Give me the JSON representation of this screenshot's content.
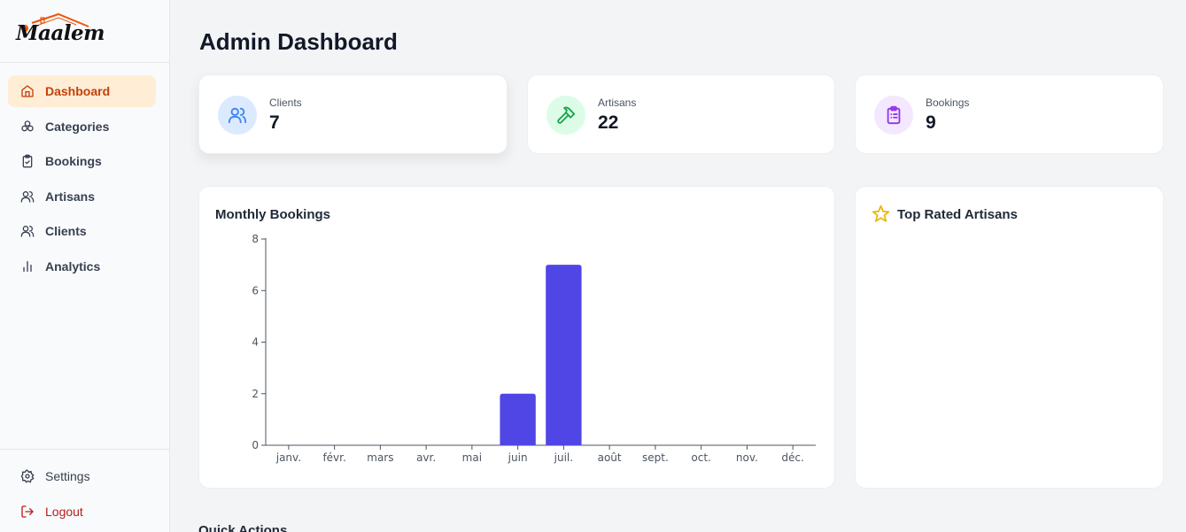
{
  "brand": {
    "name": "Maalem",
    "logo_icon": "house-roof-logo-icon"
  },
  "sidebar": {
    "items": [
      {
        "label": "Dashboard",
        "icon": "home-icon",
        "active": true
      },
      {
        "label": "Categories",
        "icon": "categories-icon",
        "active": false
      },
      {
        "label": "Bookings",
        "icon": "clipboard-check-icon",
        "active": false
      },
      {
        "label": "Artisans",
        "icon": "users-icon",
        "active": false
      },
      {
        "label": "Clients",
        "icon": "users-icon",
        "active": false
      },
      {
        "label": "Analytics",
        "icon": "bar-chart-icon",
        "active": false
      }
    ],
    "bottom": [
      {
        "label": "Settings",
        "icon": "gear-icon"
      },
      {
        "label": "Logout",
        "icon": "logout-icon"
      }
    ]
  },
  "header": {
    "title": "Admin Dashboard"
  },
  "stats": [
    {
      "label": "Clients",
      "value": "7",
      "icon": "users-icon",
      "color": "#3b82f6",
      "bg": "#dbeafe"
    },
    {
      "label": "Artisans",
      "value": "22",
      "icon": "hammer-icon",
      "color": "#16a34a",
      "bg": "#dcfce7"
    },
    {
      "label": "Bookings",
      "value": "9",
      "icon": "clipboard-list-icon",
      "color": "#9333ea",
      "bg": "#f3e8ff"
    }
  ],
  "monthly": {
    "title": "Monthly Bookings",
    "chart_data": {
      "type": "bar",
      "categories": [
        "janv.",
        "févr.",
        "mars",
        "avr.",
        "mai",
        "juin",
        "juil.",
        "août",
        "sept.",
        "oct.",
        "nov.",
        "déc."
      ],
      "values": [
        0,
        0,
        0,
        0,
        0,
        2,
        7,
        0,
        0,
        0,
        0,
        0
      ],
      "yticks": [
        "0",
        "2",
        "4",
        "6",
        "8"
      ],
      "ylim": [
        0,
        8
      ],
      "color": "#4f46e5",
      "title": "",
      "xlabel": "",
      "ylabel": ""
    }
  },
  "top_rated": {
    "title": "Top Rated Artisans",
    "icon": "star-icon"
  },
  "quick_actions": {
    "title": "Quick Actions"
  }
}
